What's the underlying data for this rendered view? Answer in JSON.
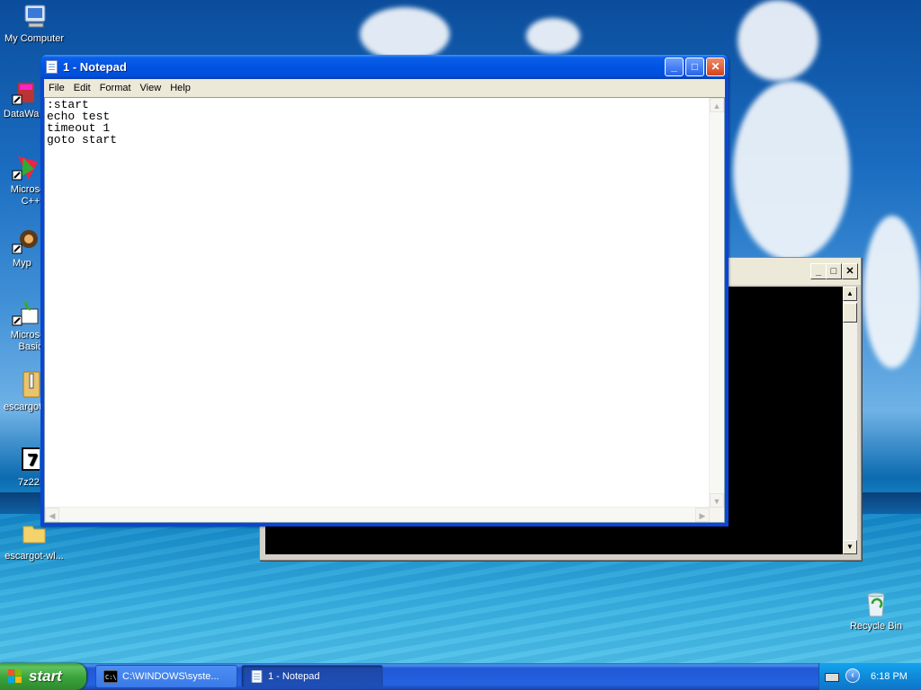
{
  "desktop": {
    "icons": [
      {
        "label": "My Computer"
      },
      {
        "label": "DataWa"
      },
      {
        "label": "Microsoft\nC++"
      },
      {
        "label": "Myp"
      },
      {
        "label": "Microsoft\nBasic"
      },
      {
        "label": "escargot"
      },
      {
        "label": "7z22"
      },
      {
        "label": "escargot-wl..."
      },
      {
        "label": "Recycle Bin"
      }
    ]
  },
  "notepad": {
    "title": "1 - Notepad",
    "menu": [
      "File",
      "Edit",
      "Format",
      "View",
      "Help"
    ],
    "content": ":start\necho test\ntimeout 1\ngoto start",
    "buttons": {
      "minimize": "_",
      "maximize": "□",
      "close": "✕"
    }
  },
  "cmd": {
    "buttons": {
      "minimize": "_",
      "maximize": "□",
      "close": "✕"
    }
  },
  "taskbar": {
    "start_label": "start",
    "items": [
      {
        "label": "C:\\WINDOWS\\syste..."
      },
      {
        "label": "1 - Notepad"
      }
    ],
    "clock": "6:18 PM"
  },
  "colors": {
    "titlebar_blue": "#0054e3",
    "start_green": "#3aa23a",
    "close_red": "#d5431c",
    "tray_blue": "#0e8ad9"
  }
}
